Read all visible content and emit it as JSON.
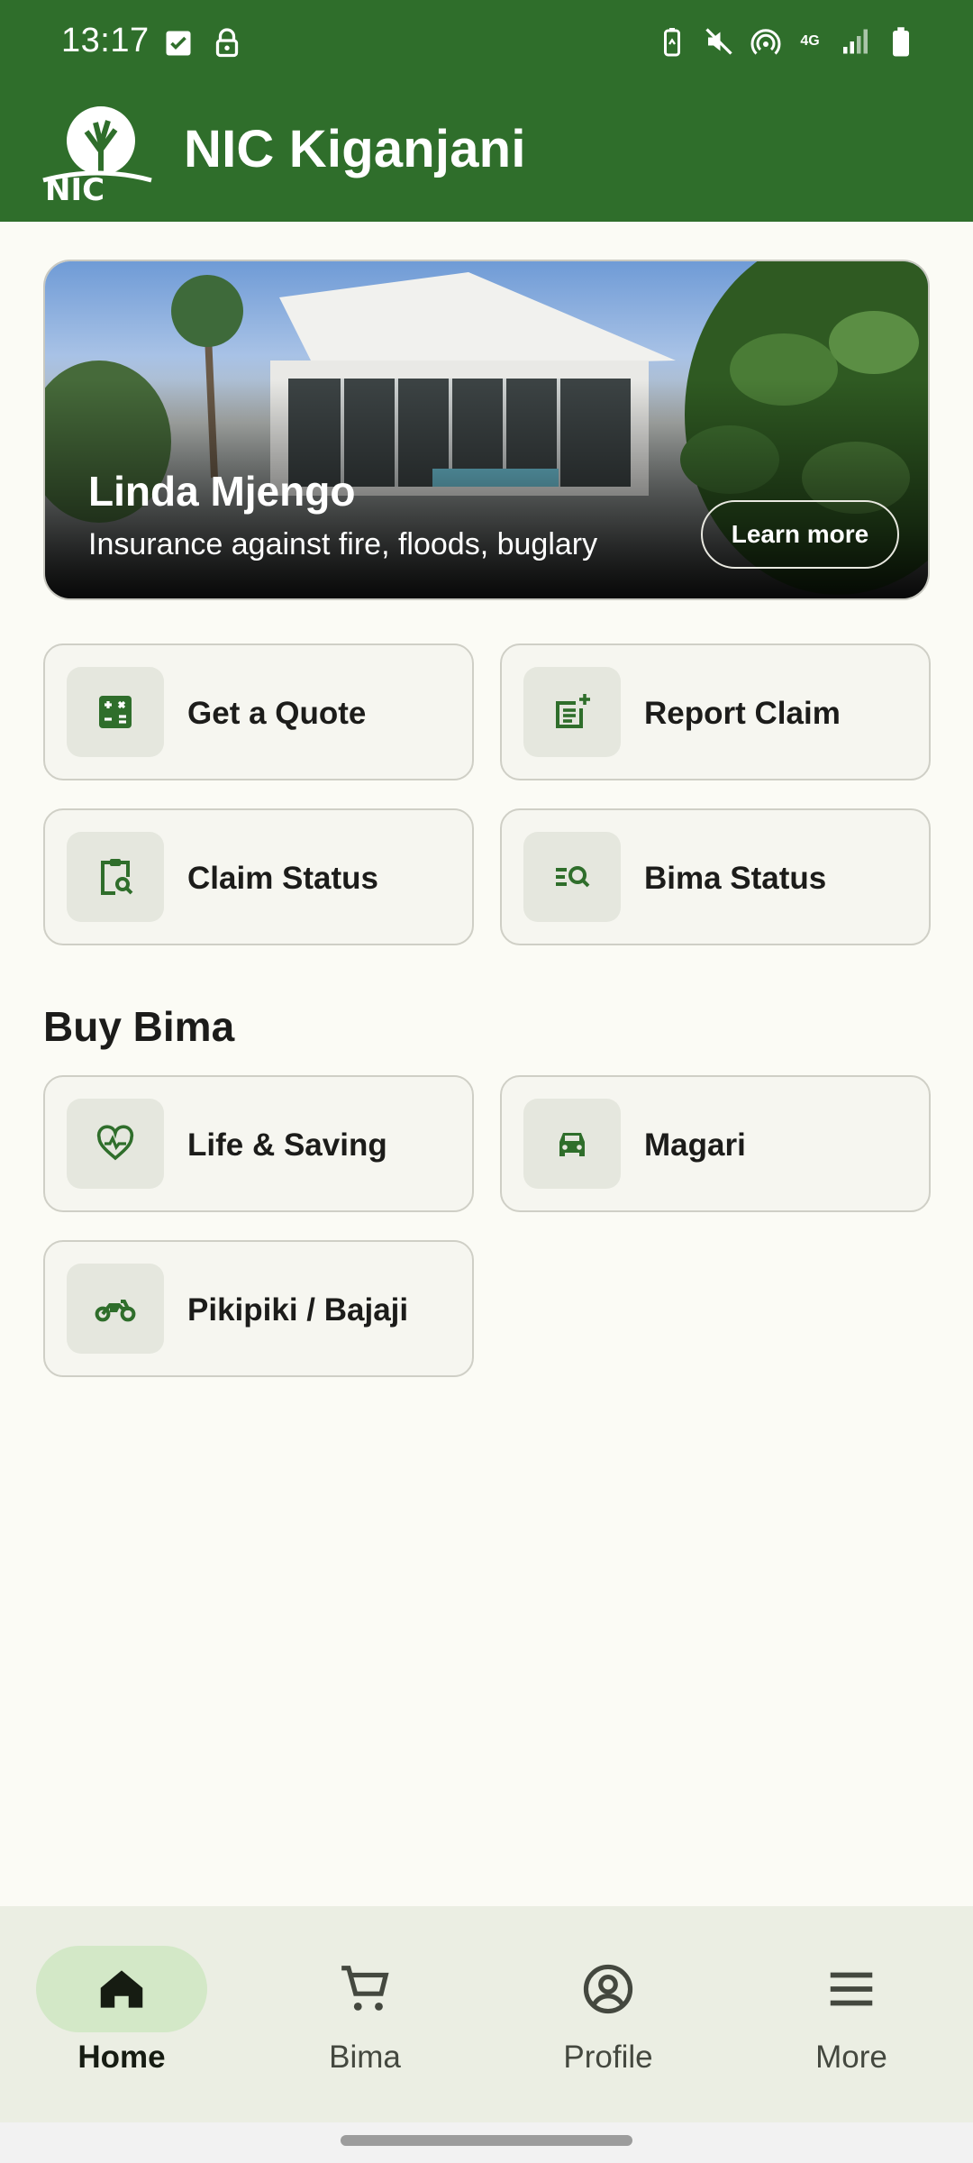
{
  "status_bar": {
    "time": "13:17",
    "network": "4G",
    "left_icons": [
      "checkbox-icon",
      "lock-icon"
    ],
    "right_icons": [
      "battery-saver-icon",
      "mute-icon",
      "hotspot-icon",
      "signal-icon",
      "battery-icon"
    ]
  },
  "app_bar": {
    "title": "NIC Kiganjani",
    "logo_text": "NIC"
  },
  "banner": {
    "title": "Linda Mjengo",
    "subtitle": "Insurance against fire, floods, buglary",
    "button_label": "Learn more"
  },
  "quick_actions": [
    {
      "label": "Get a Quote",
      "icon": "calculator-icon"
    },
    {
      "label": "Report Claim",
      "icon": "post-add-icon"
    },
    {
      "label": "Claim Status",
      "icon": "clipboard-search-icon"
    },
    {
      "label": "Bima Status",
      "icon": "list-search-icon"
    }
  ],
  "buy_bima": {
    "title": "Buy Bima",
    "items": [
      {
        "label": "Life & Saving",
        "icon": "heart-pulse-icon"
      },
      {
        "label": "Magari",
        "icon": "car-icon"
      },
      {
        "label": "Pikipiki / Bajaji",
        "icon": "motorcycle-icon"
      }
    ]
  },
  "bottom_nav": {
    "selected": "Home",
    "items": [
      {
        "label": "Home",
        "icon": "home-icon"
      },
      {
        "label": "Bima",
        "icon": "cart-icon"
      },
      {
        "label": "Profile",
        "icon": "account-circle-icon"
      },
      {
        "label": "More",
        "icon": "menu-icon"
      }
    ]
  },
  "colors": {
    "primary": "#2f6e2b",
    "background": "#fbfbf5",
    "card": "#f6f6f0",
    "icon_box": "#e5e7de",
    "nav_background": "#ebeee3",
    "nav_active_pill": "#d3e8c7"
  }
}
